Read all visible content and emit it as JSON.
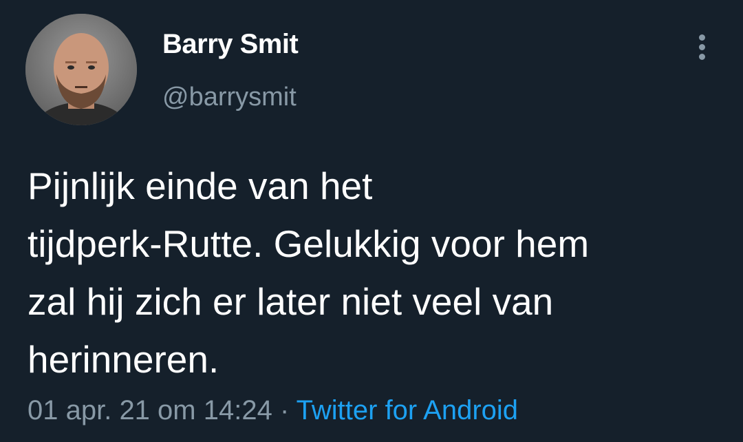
{
  "tweet": {
    "author": {
      "display_name": "Barry Smit",
      "handle": "@barrysmit",
      "avatar_icon": "avatar-photo"
    },
    "text_lines": [
      "Pijnlijk einde van het",
      "tijdperk-Rutte. Gelukkig voor hem",
      "zal hij zich er later niet veel van",
      "herinneren."
    ],
    "timestamp": "01 apr. 21 om 14:24",
    "separator": " · ",
    "source": "Twitter for Android",
    "more_icon": "more-vertical-icon"
  },
  "colors": {
    "background": "#15202b",
    "text": "#ffffff",
    "secondary_text": "#8899a6",
    "link": "#1da1f2"
  }
}
